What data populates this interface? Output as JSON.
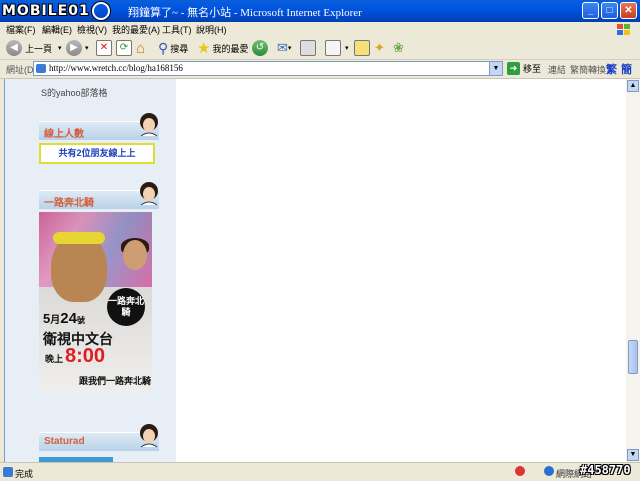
{
  "window": {
    "title": "翔鐘算了~ - 無名小站 - Microsoft Internet Explorer",
    "logo": "MOBILE01"
  },
  "menu": {
    "items": [
      "檔案(F)",
      "編輯(E)",
      "檢視(V)",
      "我的最愛(A)",
      "工具(T)",
      "說明(H)"
    ]
  },
  "toolbar": {
    "back": "上一頁",
    "search": "搜尋",
    "favorites": "我的最愛"
  },
  "address": {
    "label": "網址(D)",
    "url": "http://www.wretch.cc/blog/ha168156",
    "go": "移至",
    "links": "連結",
    "convert": "繁簡轉換",
    "trad": "繁",
    "simp": "簡"
  },
  "sidebar": {
    "yahoo_text": "S的yahoo部落格",
    "online_title": "線上人數",
    "online_text": "共有2位朋友線上上",
    "promo_title": "一路奔北騎",
    "staturad_title": "Staturad"
  },
  "poster": {
    "bubble": "一路奔北騎",
    "date_month": "5",
    "date_month_unit": "月",
    "date_day": "24",
    "date_day_unit": "號",
    "channel": "衛視中文台",
    "evening": "晚上",
    "time": "8:00",
    "tagline": "跟我們一路奔北騎"
  },
  "status": {
    "text": "完成",
    "zone": "網際網路"
  },
  "watermark": "#458770",
  "colors": {
    "titlebar": "#0054e3",
    "sidebar_bg": "#e8eef5",
    "box_title": "#d45f3a",
    "online_text": "#1d3fbf",
    "online_border": "#dede32",
    "time_red": "#e01c1c"
  }
}
